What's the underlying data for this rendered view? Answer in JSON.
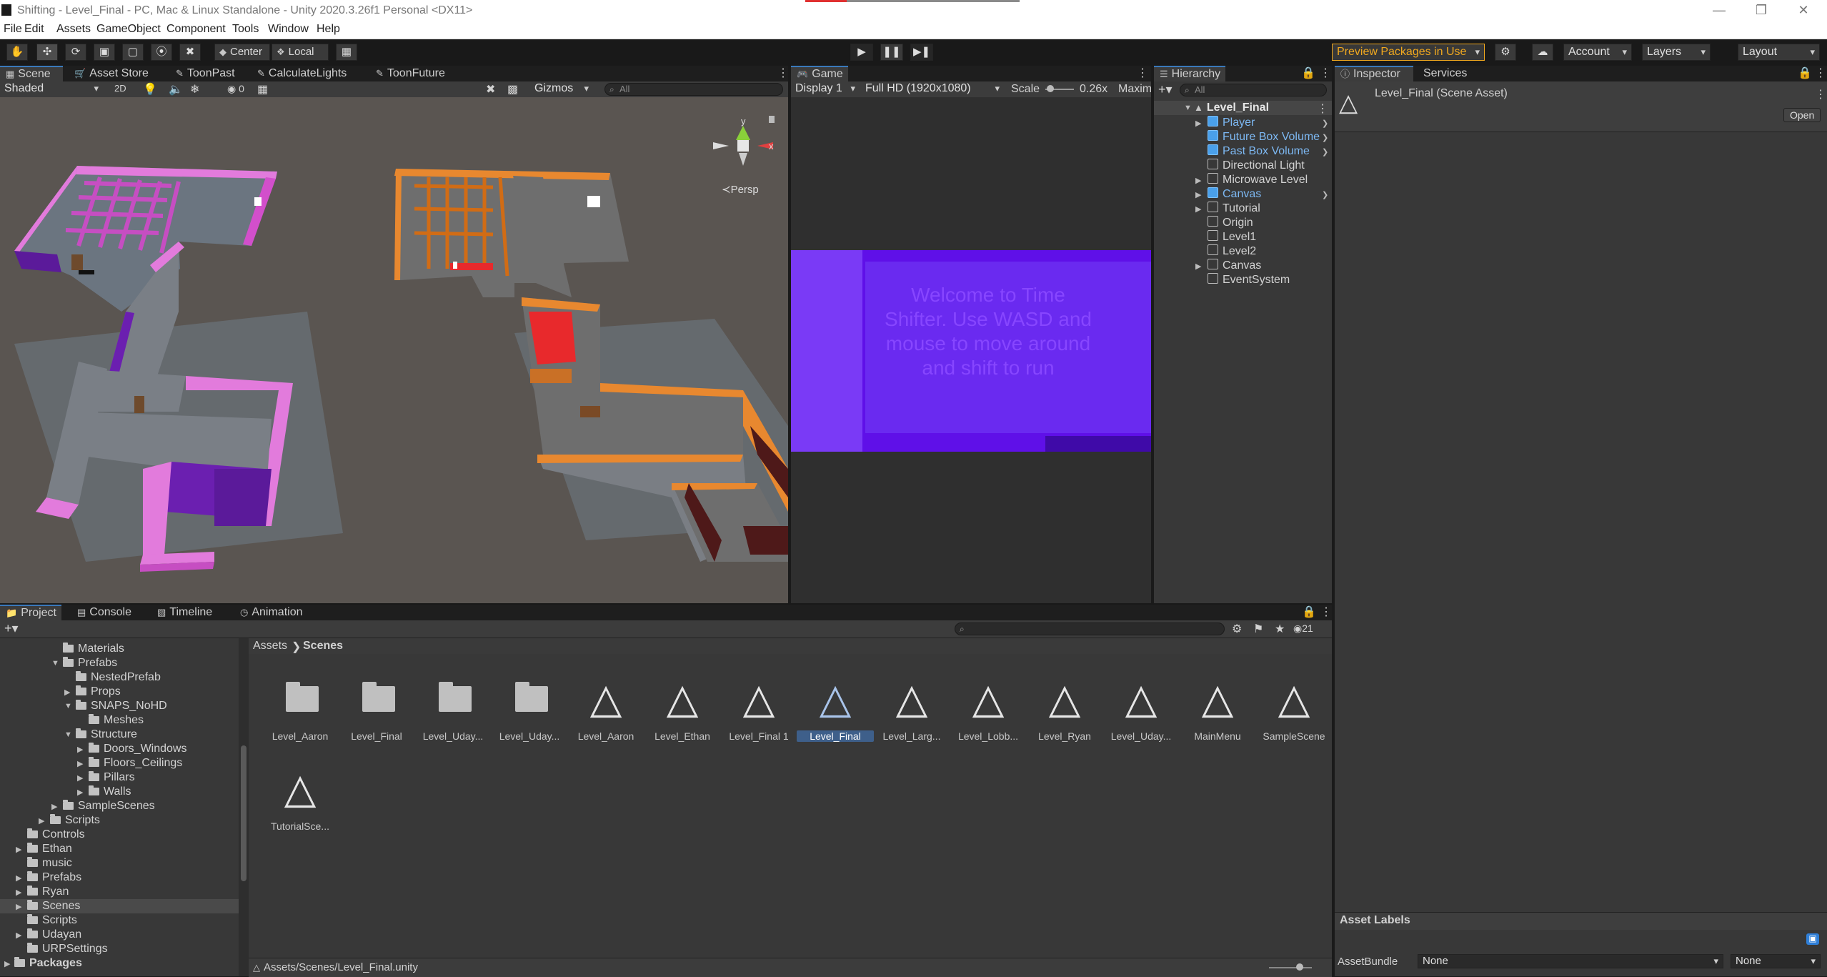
{
  "window": {
    "title": "Shifting - Level_Final - PC, Mac & Linux Standalone - Unity 2020.3.26f1 Personal <DX11>"
  },
  "menu": [
    "File",
    "Edit",
    "Assets",
    "GameObject",
    "Component",
    "Tools",
    "Window",
    "Help"
  ],
  "toolbar": {
    "pivot": "Center",
    "space": "Local",
    "preview_packages": "Preview Packages in Use",
    "account": "Account",
    "layers": "Layers",
    "layout": "Layout"
  },
  "scene_tabs": [
    "Scene",
    "Asset Store",
    "ToonPast",
    "CalculateLights",
    "ToonFuture"
  ],
  "scene": {
    "shading": "Shaded",
    "mode_2d": "2D",
    "hidden_count": "0",
    "gizmos": "Gizmos",
    "search_placeholder": "All",
    "persp": "Persp",
    "axis_y": "y",
    "axis_x": "x"
  },
  "game": {
    "tab": "Game",
    "display": "Display 1",
    "resolution": "Full HD (1920x1080)",
    "scale_label": "Scale",
    "scale_value": "0.26x",
    "maximize": "Maxim",
    "welcome_text": "Welcome to Time Shifter. Use WASD and mouse to move around and shift to run"
  },
  "hierarchy": {
    "tab": "Hierarchy",
    "search_placeholder": "All",
    "scene": "Level_Final",
    "items": [
      "Player",
      "Future Box Volume",
      "Past Box Volume",
      "Directional Light",
      "Microwave Level",
      "Canvas",
      "Tutorial",
      "Origin",
      "Level1",
      "Level2",
      "Canvas",
      "EventSystem"
    ]
  },
  "inspector": {
    "tab": "Inspector",
    "tab2": "Services",
    "asset_title": "Level_Final (Scene Asset)",
    "open_button": "Open",
    "asset_labels": "Asset Labels",
    "assetbundle_label": "AssetBundle",
    "assetbundle_value": "None",
    "variant_value": "None"
  },
  "project": {
    "tabs": [
      "Project",
      "Console",
      "Timeline",
      "Animation"
    ],
    "hidden_count": "21",
    "breadcrumb_root": "Assets",
    "breadcrumb_current": "Scenes",
    "path": "Assets/Scenes/Level_Final.unity",
    "tree": [
      "Materials",
      "Prefabs",
      "NestedPrefab",
      "Props",
      "SNAPS_NoHD",
      "Meshes",
      "Structure",
      "Doors_Windows",
      "Floors_Ceilings",
      "Pillars",
      "Walls",
      "SampleScenes",
      "Scripts",
      "Controls",
      "Ethan",
      "music",
      "Prefabs",
      "Ryan",
      "Scenes",
      "Scripts",
      "Udayan",
      "URPSettings",
      "Packages"
    ],
    "assets": [
      "Level_Aaron",
      "Level_Final",
      "Level_Uday...",
      "Level_Uday...",
      "Level_Aaron",
      "Level_Ethan",
      "Level_Final 1",
      "Level_Final",
      "Level_Larg...",
      "Level_Lobb...",
      "Level_Ryan",
      "Level_Uday...",
      "MainMenu",
      "SampleScene",
      "TutorialSce..."
    ]
  },
  "colors": {
    "accent": "#3a79bb",
    "prefab_blue": "#7db8f2",
    "preview_orange": "#f0a81f",
    "canvas_purple": "#5f10e8"
  }
}
